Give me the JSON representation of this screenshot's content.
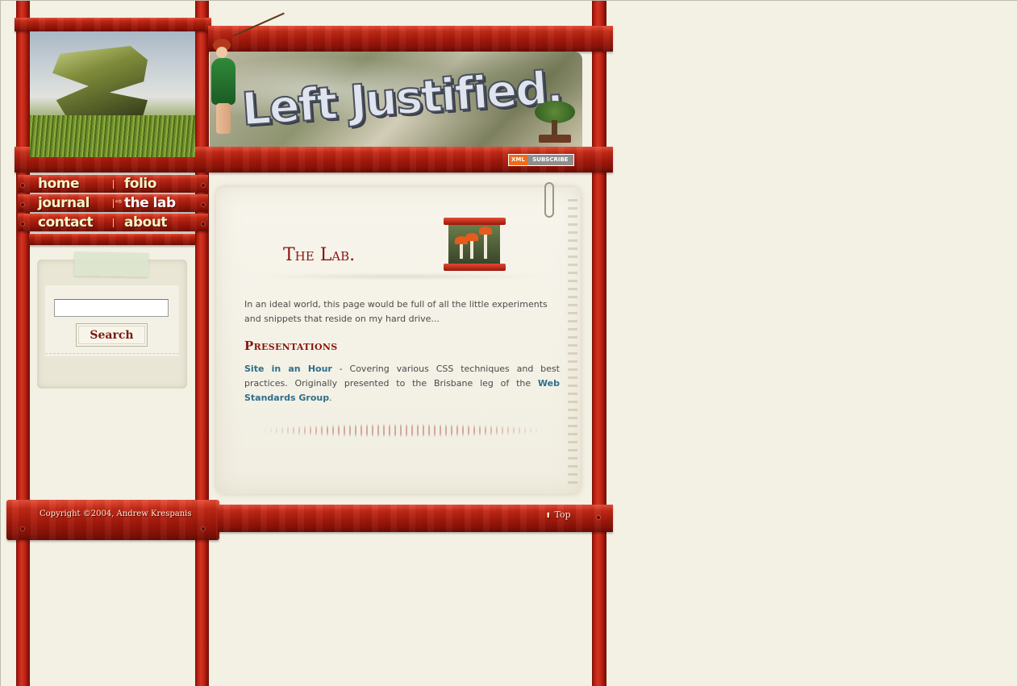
{
  "site": {
    "logo_text": "Left Justified.",
    "feed_badge": {
      "left": "XML",
      "right": "SUBSCRIBE"
    }
  },
  "nav": {
    "items": [
      {
        "label": "home"
      },
      {
        "label": "folio"
      },
      {
        "label": "journal"
      },
      {
        "label": "the lab",
        "current": true
      },
      {
        "label": "contact"
      },
      {
        "label": "about"
      }
    ]
  },
  "search": {
    "input_value": "",
    "button_label": "Search"
  },
  "main": {
    "title": "The Lab.",
    "intro": "In an ideal world, this page would be full of all the little experiments and snippets that reside on my hard drive...",
    "section_heading": "Presentations",
    "entry": {
      "link1": "Site in an Hour",
      "text1": " - Covering various CSS techniques and best practices. Originally presented to the Brisbane leg of the ",
      "link2": "Web Standards Group",
      "text2": "."
    }
  },
  "footer": {
    "copyright": "Copyright ©2004, Andrew Krespanis",
    "top_label": "Top"
  },
  "colors": {
    "wood": "#b81f12",
    "page_bg": "#f3f0e4",
    "title": "#8a1510",
    "link": "#2d6f8c",
    "nav_text": "#f4f6c8"
  },
  "icons": [
    "rss-xml-badge",
    "arrow-right-icon",
    "arrow-up-icon",
    "paperclip-icon",
    "mushroom-frame-icon"
  ]
}
